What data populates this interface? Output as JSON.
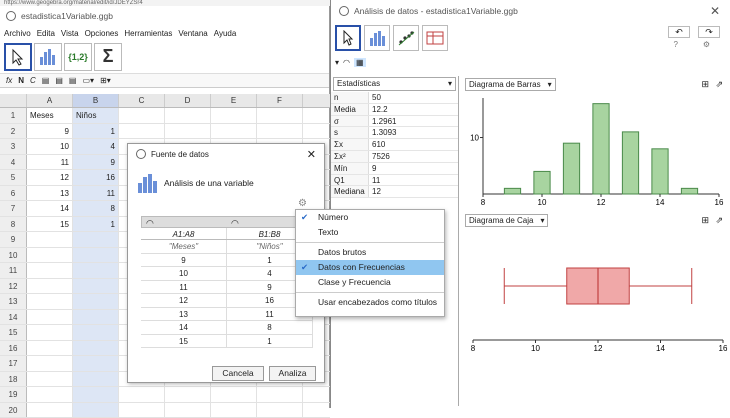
{
  "url_bar": "https://www.geogebra.org/material/edit/id/JDEYZSr4",
  "main": {
    "title": "estadistica1Variable.ggb",
    "menu": [
      "Archivo",
      "Edita",
      "Vista",
      "Opciones",
      "Herramientas",
      "Ventana",
      "Ayuda"
    ],
    "format_bar": {
      "fx": "fx",
      "bold": "N",
      "italic": "C"
    },
    "columns": [
      "",
      "A",
      "B",
      "C",
      "D",
      "E",
      "F"
    ],
    "rows": [
      {
        "n": "1",
        "a": "Meses",
        "b": "Niños"
      },
      {
        "n": "2",
        "a": "9",
        "b": "1"
      },
      {
        "n": "3",
        "a": "10",
        "b": "4"
      },
      {
        "n": "4",
        "a": "11",
        "b": "9"
      },
      {
        "n": "5",
        "a": "12",
        "b": "16"
      },
      {
        "n": "6",
        "a": "13",
        "b": "11"
      },
      {
        "n": "7",
        "a": "14",
        "b": "8"
      },
      {
        "n": "8",
        "a": "15",
        "b": "1"
      },
      {
        "n": "9",
        "a": "",
        "b": ""
      },
      {
        "n": "10",
        "a": "",
        "b": ""
      },
      {
        "n": "11",
        "a": "",
        "b": ""
      },
      {
        "n": "12",
        "a": "",
        "b": ""
      },
      {
        "n": "13",
        "a": "",
        "b": ""
      },
      {
        "n": "14",
        "a": "",
        "b": ""
      },
      {
        "n": "15",
        "a": "",
        "b": ""
      },
      {
        "n": "16",
        "a": "",
        "b": ""
      },
      {
        "n": "17",
        "a": "",
        "b": ""
      },
      {
        "n": "18",
        "a": "",
        "b": ""
      },
      {
        "n": "19",
        "a": "",
        "b": ""
      },
      {
        "n": "20",
        "a": "",
        "b": ""
      }
    ]
  },
  "analysis": {
    "title": "Análisis de datos - estadistica1Variable.ggb",
    "stats_combo": "Estadísticas",
    "stats": [
      {
        "k": "n",
        "v": "50"
      },
      {
        "k": "Media",
        "v": "12.2"
      },
      {
        "k": "σ",
        "v": "1.2961"
      },
      {
        "k": "s",
        "v": "1.3093"
      },
      {
        "k": "Σx",
        "v": "610"
      },
      {
        "k": "Σx²",
        "v": "7526"
      },
      {
        "k": "Mín",
        "v": "9"
      },
      {
        "k": "Q1",
        "v": "11"
      },
      {
        "k": "Mediana",
        "v": "12"
      }
    ],
    "chart1_label": "Diagrama de Barras",
    "chart2_label": "Diagrama de Caja"
  },
  "chart_data": [
    {
      "type": "bar",
      "categories": [
        "9",
        "10",
        "11",
        "12",
        "13",
        "14",
        "15"
      ],
      "values": [
        1,
        4,
        9,
        16,
        11,
        8,
        1
      ],
      "x_ticks": [
        "8",
        "10",
        "12",
        "14",
        "16"
      ],
      "y_ticks": [
        "10"
      ],
      "xlim": [
        8,
        16
      ],
      "ylim": [
        0,
        17
      ],
      "color": "#a8d4a0"
    },
    {
      "type": "box",
      "min": 9,
      "q1": 11,
      "median": 12,
      "q3": 13,
      "max": 15,
      "x_ticks": [
        "8",
        "10",
        "12",
        "14",
        "16"
      ],
      "xlim": [
        8,
        16
      ],
      "color": "#f0a8a8"
    }
  ],
  "dialog": {
    "title": "Fuente de datos",
    "heading": "Análisis de una variable",
    "col1_range": "A1:A8",
    "col2_range": "B1:B8",
    "col1_header": "\"Meses\"",
    "col2_header": "\"Niños\"",
    "rows": [
      [
        "9",
        "1"
      ],
      [
        "10",
        "4"
      ],
      [
        "11",
        "9"
      ],
      [
        "12",
        "16"
      ],
      [
        "13",
        "11"
      ],
      [
        "14",
        "8"
      ],
      [
        "15",
        "1"
      ]
    ],
    "cancel": "Cancela",
    "analyze": "Analiza"
  },
  "context_menu": {
    "items": [
      {
        "label": "Número",
        "checked": true
      },
      {
        "label": "Texto",
        "checked": false
      },
      {
        "label": "Datos brutos",
        "checked": false
      },
      {
        "label": "Datos con Frecuencias",
        "checked": true,
        "highlighted": true
      },
      {
        "label": "Clase y Frecuencia",
        "checked": false
      },
      {
        "label": "Usar encabezados como títulos",
        "checked": false
      }
    ]
  }
}
